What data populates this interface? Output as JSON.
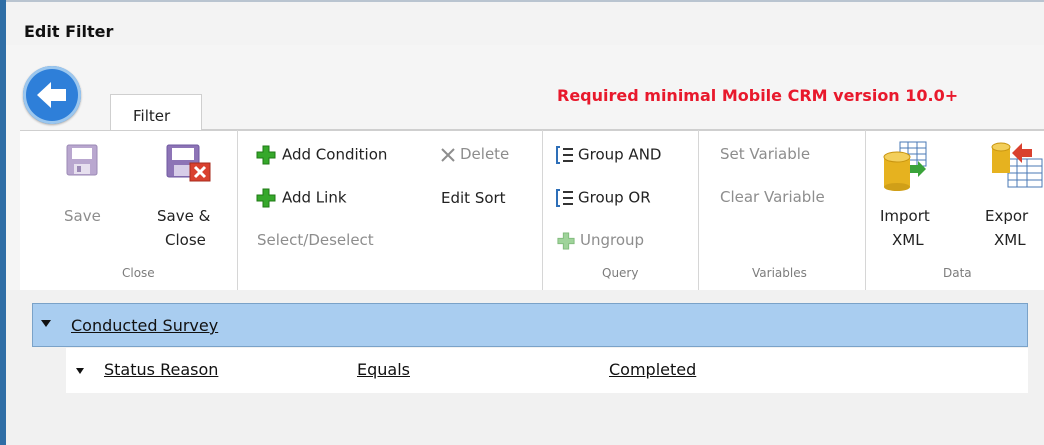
{
  "window": {
    "title": "Edit Filter"
  },
  "tabs": [
    {
      "label": "Filter",
      "selected": true
    }
  ],
  "notice": {
    "text": "Required minimal Mobile CRM version 10.0+",
    "color": "#e8192c"
  },
  "ribbon": {
    "close_group": {
      "label": "Close",
      "save_label": "Save",
      "save_close_line1": "Save &",
      "save_close_line2": "Close"
    },
    "edit_group": {
      "add_condition": "Add Condition",
      "delete": "Delete",
      "add_link": "Add Link",
      "edit_sort": "Edit Sort",
      "select_deselect": "Select/Deselect"
    },
    "query_group": {
      "label": "Query",
      "group_and": "Group AND",
      "group_or": "Group OR",
      "ungroup": "Ungroup"
    },
    "variables_group": {
      "label": "Variables",
      "set_variable": "Set Variable",
      "clear_variable": "Clear Variable"
    },
    "data_group": {
      "label": "Data",
      "import_line1": "Import",
      "import_line2": "XML",
      "export_line1": "Expor",
      "export_line2": "XML"
    }
  },
  "tree": {
    "entity": "Conducted Survey",
    "conditions": [
      {
        "field": "Status Reason",
        "operator": "Equals",
        "value": "Completed"
      }
    ]
  },
  "colors": {
    "accent": "#2e7fd9",
    "selection": "#a9cdf0",
    "border": "#2f6ea6"
  }
}
